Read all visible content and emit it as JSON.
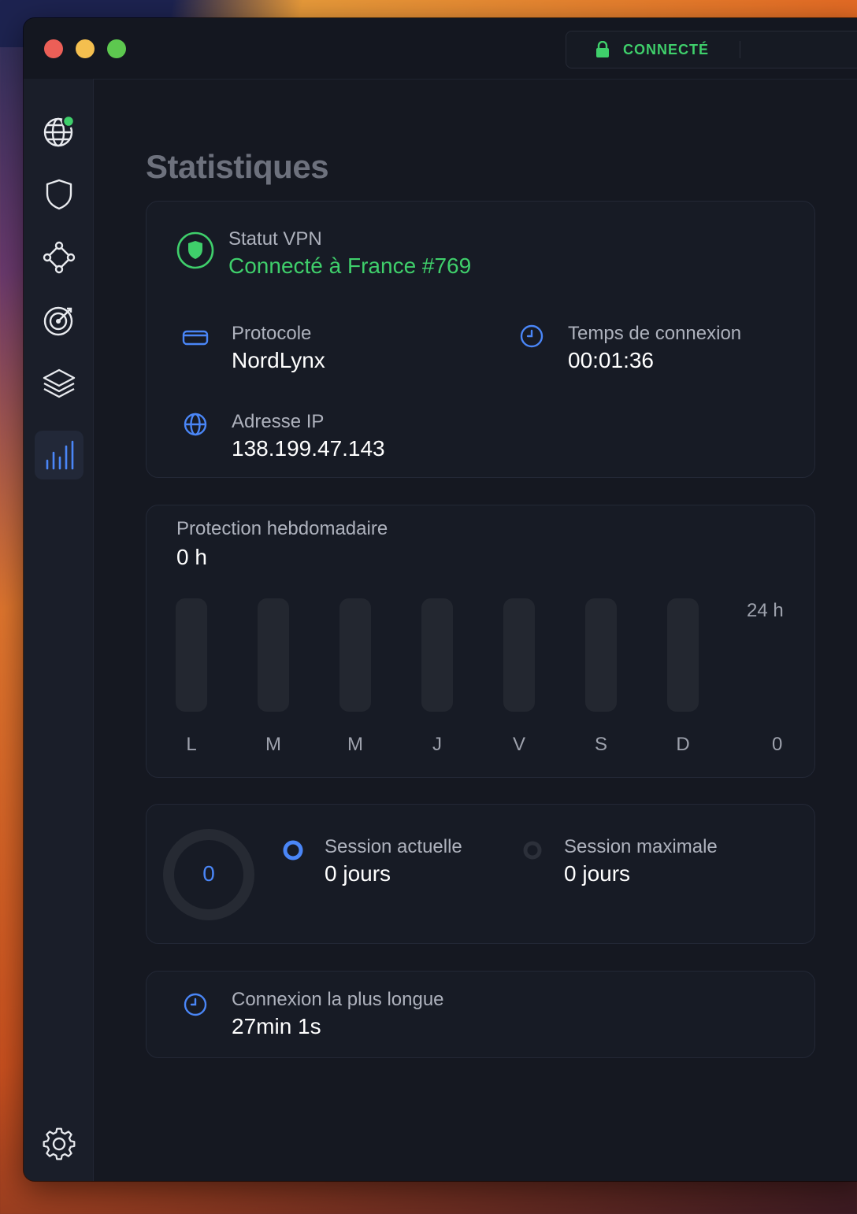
{
  "titlebar": {
    "status": "CONNECTÉ"
  },
  "page": {
    "title": "Statistiques"
  },
  "vpn": {
    "status_label": "Statut VPN",
    "status_value": "Connecté à France #769",
    "protocol_label": "Protocole",
    "protocol_value": "NordLynx",
    "time_label": "Temps de connexion",
    "time_value": "00:01:36",
    "ip_label": "Adresse IP",
    "ip_value": "138.199.47.143"
  },
  "weekly": {
    "title": "Protection hebdomadaire",
    "total": "0 h",
    "axis_max": "24 h",
    "axis_min": "0",
    "days": [
      "L",
      "M",
      "M",
      "J",
      "V",
      "S",
      "D"
    ]
  },
  "chart_data": {
    "type": "bar",
    "categories": [
      "L",
      "M",
      "M",
      "J",
      "V",
      "S",
      "D"
    ],
    "values": [
      0,
      0,
      0,
      0,
      0,
      0,
      0
    ],
    "title": "Protection hebdomadaire",
    "ylim": [
      0,
      24
    ]
  },
  "streak": {
    "ring_value": "0",
    "current_label": "Session actuelle",
    "current_value": "0 jours",
    "max_label": "Session maximale",
    "max_value": "0 jours"
  },
  "longest": {
    "label": "Connexion la plus longue",
    "value": "27min 1s"
  },
  "colors": {
    "accent": "#4a86f7",
    "connected": "#3fcf6b",
    "background": "#151821",
    "card": "#171b25"
  }
}
